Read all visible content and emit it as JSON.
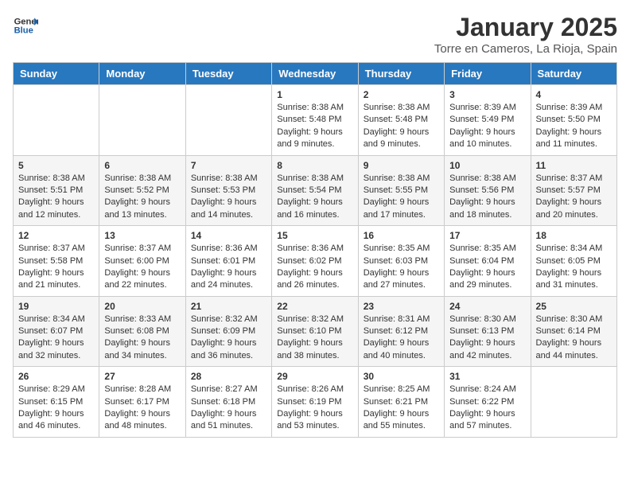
{
  "header": {
    "logo_line1": "General",
    "logo_line2": "Blue",
    "month": "January 2025",
    "location": "Torre en Cameros, La Rioja, Spain"
  },
  "weekdays": [
    "Sunday",
    "Monday",
    "Tuesday",
    "Wednesday",
    "Thursday",
    "Friday",
    "Saturday"
  ],
  "weeks": [
    [
      {
        "day": "",
        "info": ""
      },
      {
        "day": "",
        "info": ""
      },
      {
        "day": "",
        "info": ""
      },
      {
        "day": "1",
        "info": "Sunrise: 8:38 AM\nSunset: 5:48 PM\nDaylight: 9 hours\nand 9 minutes."
      },
      {
        "day": "2",
        "info": "Sunrise: 8:38 AM\nSunset: 5:48 PM\nDaylight: 9 hours\nand 9 minutes."
      },
      {
        "day": "3",
        "info": "Sunrise: 8:39 AM\nSunset: 5:49 PM\nDaylight: 9 hours\nand 10 minutes."
      },
      {
        "day": "4",
        "info": "Sunrise: 8:39 AM\nSunset: 5:50 PM\nDaylight: 9 hours\nand 11 minutes."
      }
    ],
    [
      {
        "day": "5",
        "info": "Sunrise: 8:38 AM\nSunset: 5:51 PM\nDaylight: 9 hours\nand 12 minutes."
      },
      {
        "day": "6",
        "info": "Sunrise: 8:38 AM\nSunset: 5:52 PM\nDaylight: 9 hours\nand 13 minutes."
      },
      {
        "day": "7",
        "info": "Sunrise: 8:38 AM\nSunset: 5:53 PM\nDaylight: 9 hours\nand 14 minutes."
      },
      {
        "day": "8",
        "info": "Sunrise: 8:38 AM\nSunset: 5:54 PM\nDaylight: 9 hours\nand 16 minutes."
      },
      {
        "day": "9",
        "info": "Sunrise: 8:38 AM\nSunset: 5:55 PM\nDaylight: 9 hours\nand 17 minutes."
      },
      {
        "day": "10",
        "info": "Sunrise: 8:38 AM\nSunset: 5:56 PM\nDaylight: 9 hours\nand 18 minutes."
      },
      {
        "day": "11",
        "info": "Sunrise: 8:37 AM\nSunset: 5:57 PM\nDaylight: 9 hours\nand 20 minutes."
      }
    ],
    [
      {
        "day": "12",
        "info": "Sunrise: 8:37 AM\nSunset: 5:58 PM\nDaylight: 9 hours\nand 21 minutes."
      },
      {
        "day": "13",
        "info": "Sunrise: 8:37 AM\nSunset: 6:00 PM\nDaylight: 9 hours\nand 22 minutes."
      },
      {
        "day": "14",
        "info": "Sunrise: 8:36 AM\nSunset: 6:01 PM\nDaylight: 9 hours\nand 24 minutes."
      },
      {
        "day": "15",
        "info": "Sunrise: 8:36 AM\nSunset: 6:02 PM\nDaylight: 9 hours\nand 26 minutes."
      },
      {
        "day": "16",
        "info": "Sunrise: 8:35 AM\nSunset: 6:03 PM\nDaylight: 9 hours\nand 27 minutes."
      },
      {
        "day": "17",
        "info": "Sunrise: 8:35 AM\nSunset: 6:04 PM\nDaylight: 9 hours\nand 29 minutes."
      },
      {
        "day": "18",
        "info": "Sunrise: 8:34 AM\nSunset: 6:05 PM\nDaylight: 9 hours\nand 31 minutes."
      }
    ],
    [
      {
        "day": "19",
        "info": "Sunrise: 8:34 AM\nSunset: 6:07 PM\nDaylight: 9 hours\nand 32 minutes."
      },
      {
        "day": "20",
        "info": "Sunrise: 8:33 AM\nSunset: 6:08 PM\nDaylight: 9 hours\nand 34 minutes."
      },
      {
        "day": "21",
        "info": "Sunrise: 8:32 AM\nSunset: 6:09 PM\nDaylight: 9 hours\nand 36 minutes."
      },
      {
        "day": "22",
        "info": "Sunrise: 8:32 AM\nSunset: 6:10 PM\nDaylight: 9 hours\nand 38 minutes."
      },
      {
        "day": "23",
        "info": "Sunrise: 8:31 AM\nSunset: 6:12 PM\nDaylight: 9 hours\nand 40 minutes."
      },
      {
        "day": "24",
        "info": "Sunrise: 8:30 AM\nSunset: 6:13 PM\nDaylight: 9 hours\nand 42 minutes."
      },
      {
        "day": "25",
        "info": "Sunrise: 8:30 AM\nSunset: 6:14 PM\nDaylight: 9 hours\nand 44 minutes."
      }
    ],
    [
      {
        "day": "26",
        "info": "Sunrise: 8:29 AM\nSunset: 6:15 PM\nDaylight: 9 hours\nand 46 minutes."
      },
      {
        "day": "27",
        "info": "Sunrise: 8:28 AM\nSunset: 6:17 PM\nDaylight: 9 hours\nand 48 minutes."
      },
      {
        "day": "28",
        "info": "Sunrise: 8:27 AM\nSunset: 6:18 PM\nDaylight: 9 hours\nand 51 minutes."
      },
      {
        "day": "29",
        "info": "Sunrise: 8:26 AM\nSunset: 6:19 PM\nDaylight: 9 hours\nand 53 minutes."
      },
      {
        "day": "30",
        "info": "Sunrise: 8:25 AM\nSunset: 6:21 PM\nDaylight: 9 hours\nand 55 minutes."
      },
      {
        "day": "31",
        "info": "Sunrise: 8:24 AM\nSunset: 6:22 PM\nDaylight: 9 hours\nand 57 minutes."
      },
      {
        "day": "",
        "info": ""
      }
    ]
  ]
}
